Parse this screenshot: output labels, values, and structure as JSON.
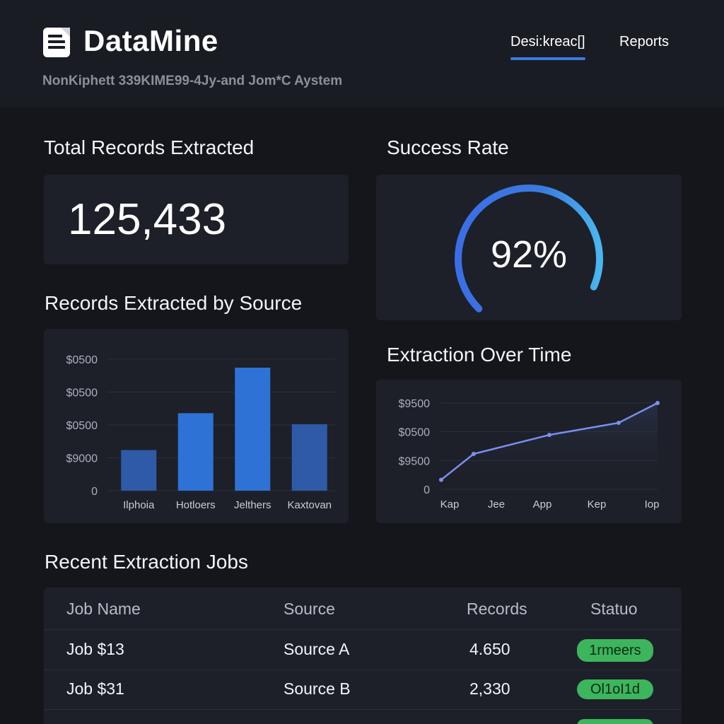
{
  "app": {
    "title": "DataMine",
    "subtitle": "NonKiphett 339KIME99-4Jy-and Jom*C Aystem"
  },
  "nav": {
    "tabs": [
      {
        "label": "Desi:kreac[]",
        "active": true
      },
      {
        "label": "Reports",
        "active": false
      }
    ]
  },
  "total_records": {
    "title": "Total Records Extracted",
    "value": "125,433"
  },
  "success_rate": {
    "title": "Success Rate",
    "value": "92%",
    "fraction": 0.92
  },
  "colors": {
    "accent": "#3b7be0",
    "bar_dark": "#2e5aa8",
    "bar_bright": "#2f72d6",
    "line": "#7b8ff0",
    "success_badge": "#3cb55c",
    "background": "#14161c",
    "card": "#1d2028"
  },
  "chart_data": [
    {
      "type": "bar",
      "title": "Records Extracted by Source",
      "categories": [
        "Ilphoia",
        "Hotloers",
        "Jelthers",
        "Kaxtovan"
      ],
      "values": [
        0.33,
        0.63,
        1.0,
        0.54
      ],
      "ytick_labels": [
        "$0500",
        "$0500",
        "$0500",
        "$9000",
        "0"
      ],
      "grid": true
    },
    {
      "type": "line",
      "title": "Extraction Over Time",
      "categories": [
        "Kap",
        "Jee",
        "App",
        "Kep",
        "Iop"
      ],
      "x": [
        0,
        0.15,
        0.5,
        0.82,
        1.0
      ],
      "values": [
        0.11,
        0.41,
        0.63,
        0.77,
        1.0
      ],
      "ytick_labels": [
        "$9500",
        "$0500",
        "$9500",
        "0"
      ],
      "grid": true
    }
  ],
  "jobs_table": {
    "title": "Recent Extraction Jobs",
    "headers": [
      "Job Name",
      "Source",
      "Records",
      "Statuo"
    ],
    "rows": [
      {
        "job": "Job $13",
        "source": "Source A",
        "records": "4.650",
        "status": "1rmeers"
      },
      {
        "job": "Job $31",
        "source": "Source B",
        "records": "2,330",
        "status": "Ol1oI1d"
      },
      {
        "job": "",
        "source": "",
        "records": "",
        "status": ""
      }
    ]
  }
}
